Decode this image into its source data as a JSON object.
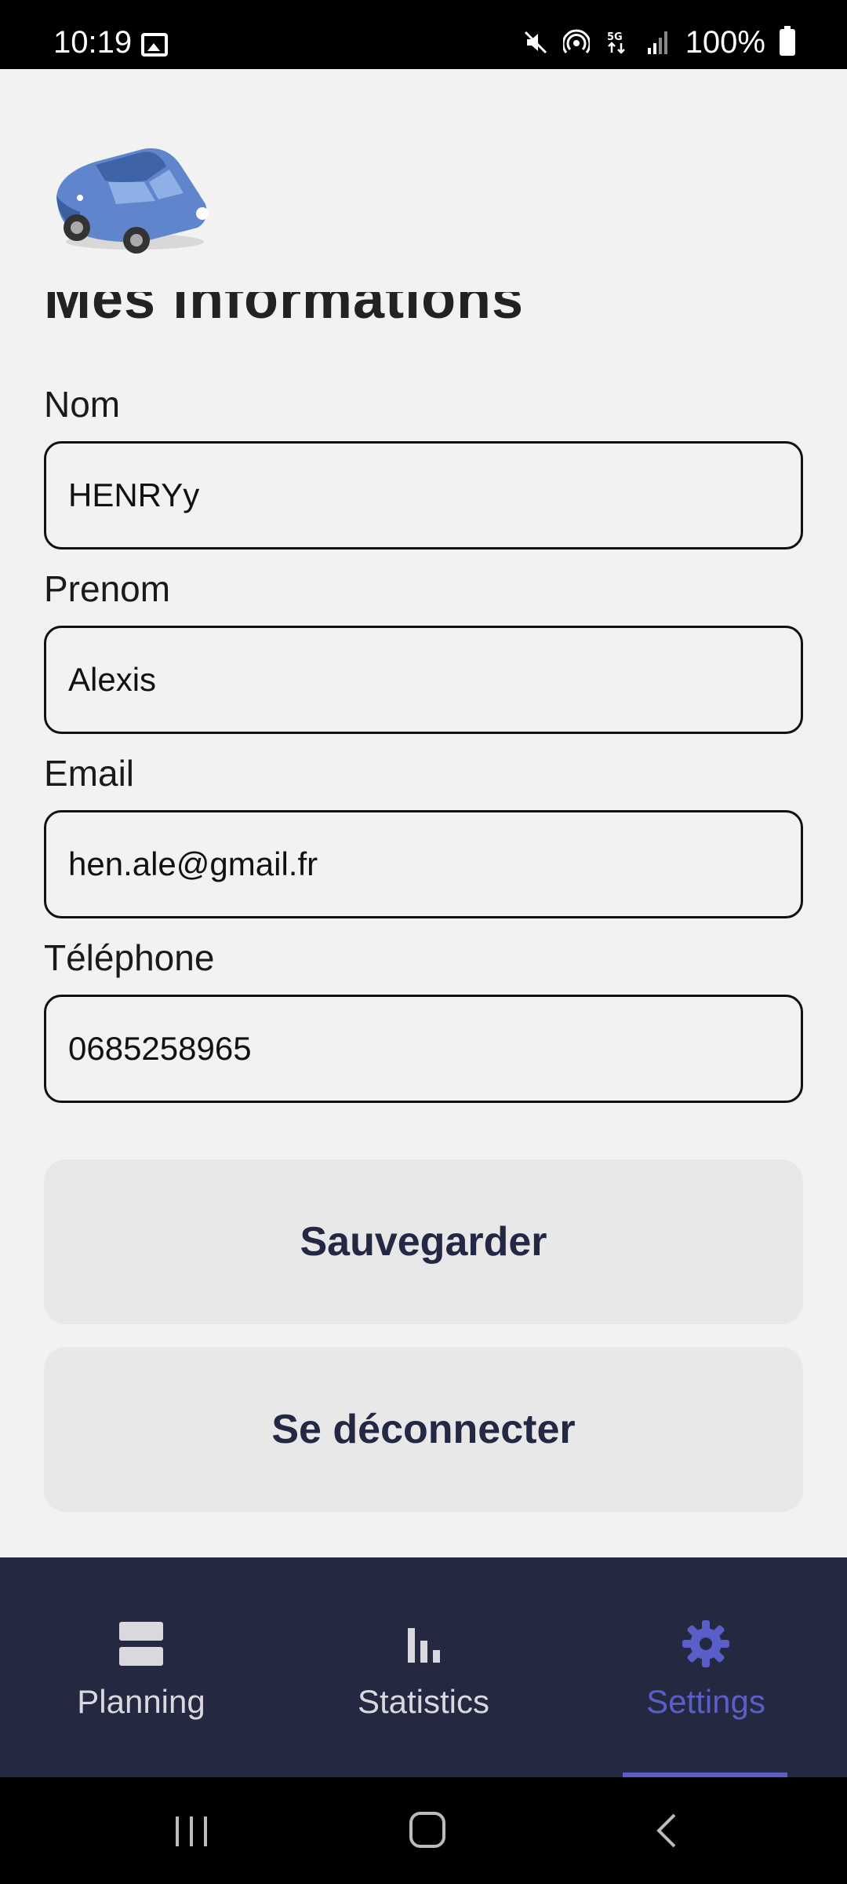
{
  "status_bar": {
    "time": "10:19",
    "battery": "100%",
    "icons": [
      "image-icon",
      "mute-icon",
      "hotspot-icon",
      "5g-icon",
      "signal-icon",
      "battery-icon"
    ]
  },
  "header": {
    "logo": "car-logo",
    "title_clipped": "Mes informations"
  },
  "form": {
    "nom": {
      "label": "Nom",
      "value": "HENRYy"
    },
    "prenom": {
      "label": "Prenom",
      "value": "Alexis"
    },
    "email": {
      "label": "Email",
      "value": "hen.ale@gmail.fr"
    },
    "telephone": {
      "label": "Téléphone",
      "value": "0685258965"
    }
  },
  "actions": {
    "save_label": "Sauvegarder",
    "logout_label": "Se déconnecter"
  },
  "bottom_nav": {
    "items": [
      {
        "label": "Planning",
        "icon": "planning-icon",
        "active": false
      },
      {
        "label": "Statistics",
        "icon": "bar-chart-icon",
        "active": false
      },
      {
        "label": "Settings",
        "icon": "gear-icon",
        "active": true
      }
    ]
  },
  "colors": {
    "nav_background": "#242840",
    "accent": "#5a5ec8",
    "button_text": "#232844",
    "button_background": "#e8e8e8"
  }
}
